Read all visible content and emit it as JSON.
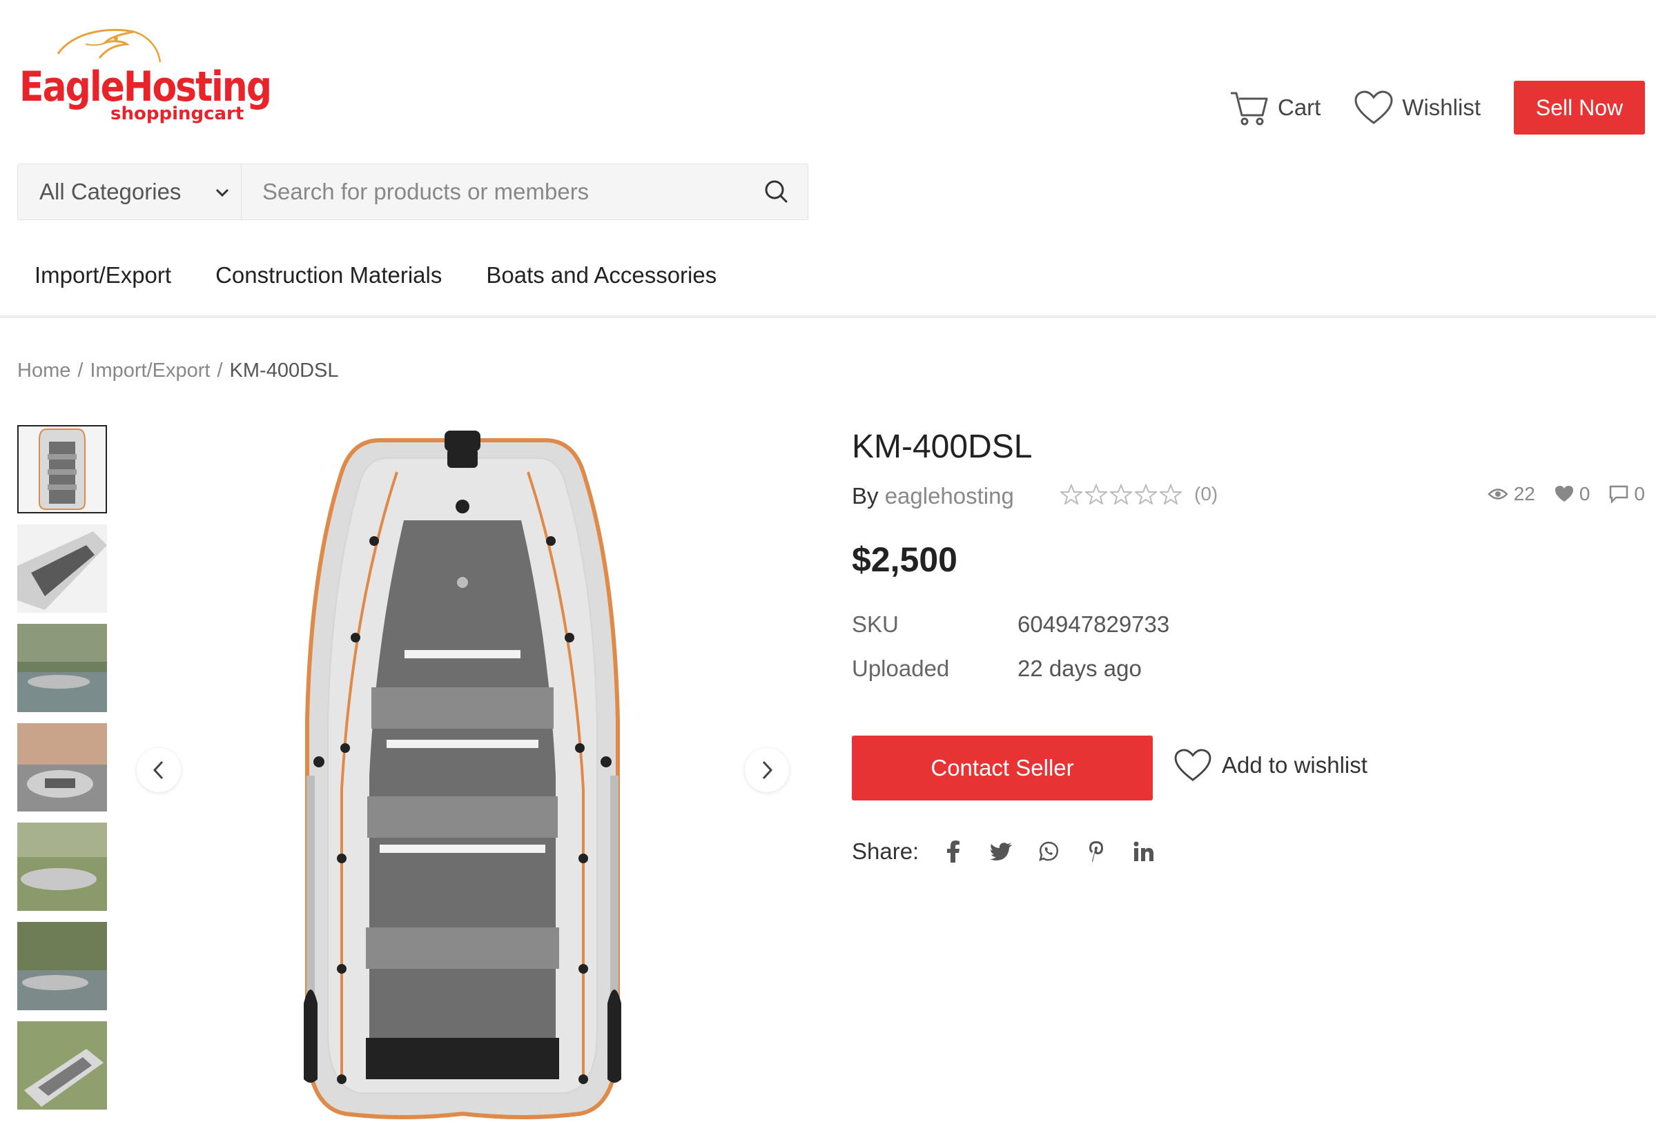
{
  "brand": {
    "name": "EagleHosting",
    "tagline": "shoppingcart",
    "color": "#e8232a"
  },
  "header": {
    "cart_label": "Cart",
    "wishlist_label": "Wishlist",
    "sell_label": "Sell Now",
    "icons": {
      "cart": "cart-icon",
      "wishlist": "heart-icon"
    }
  },
  "search": {
    "category": "All Categories",
    "placeholder": "Search for products or members",
    "value": ""
  },
  "nav": {
    "items": [
      "Import/Export",
      "Construction Materials",
      "Boats and Accessories"
    ]
  },
  "breadcrumb": {
    "items": [
      "Home",
      "Import/Export",
      "KM-400DSL"
    ],
    "separator": "/"
  },
  "product": {
    "title": "KM-400DSL",
    "by_label": "By",
    "seller": "eaglehosting",
    "rating": {
      "value": 0,
      "max": 5,
      "count_label": "(0)"
    },
    "stats": {
      "views": "22",
      "likes": "0",
      "comments": "0"
    },
    "price": "$2,500",
    "meta": [
      {
        "key": "SKU",
        "value": "604947829733"
      },
      {
        "key": "Uploaded",
        "value": "22 days ago"
      }
    ],
    "contact_label": "Contact Seller",
    "add_wishlist_label": "Add to wishlist",
    "share_label": "Share:",
    "share_icons": [
      "facebook-icon",
      "twitter-icon",
      "whatsapp-icon",
      "pinterest-icon",
      "linkedin-icon"
    ]
  },
  "gallery": {
    "thumbnail_count": 7,
    "active_index": 0
  },
  "colors": {
    "accent": "#e83335",
    "text": "#222222",
    "muted": "#888888"
  }
}
